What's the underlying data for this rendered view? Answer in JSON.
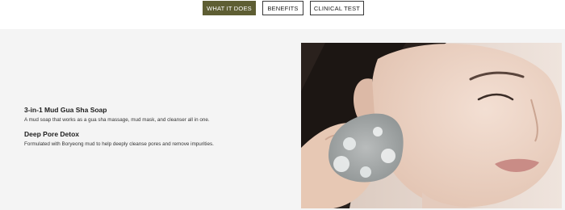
{
  "tabs": [
    {
      "label": "WHAT IT DOES",
      "active": true
    },
    {
      "label": "BENEFITS",
      "active": false
    },
    {
      "label": "CLINICAL TEST",
      "active": false
    }
  ],
  "content": {
    "heading1": "3-in-1 Mud Gua Sha Soap",
    "text1": "A mud soap that works as a gua sha massage, mud mask, and cleanser all in one.",
    "heading2": "Deep Pore Detox",
    "text2": "Formulated with Boryeong mud to help deeply cleanse pores and remove impurities."
  },
  "colors": {
    "active_tab": "#5e5e33",
    "section_bg": "#f4f4f4"
  }
}
